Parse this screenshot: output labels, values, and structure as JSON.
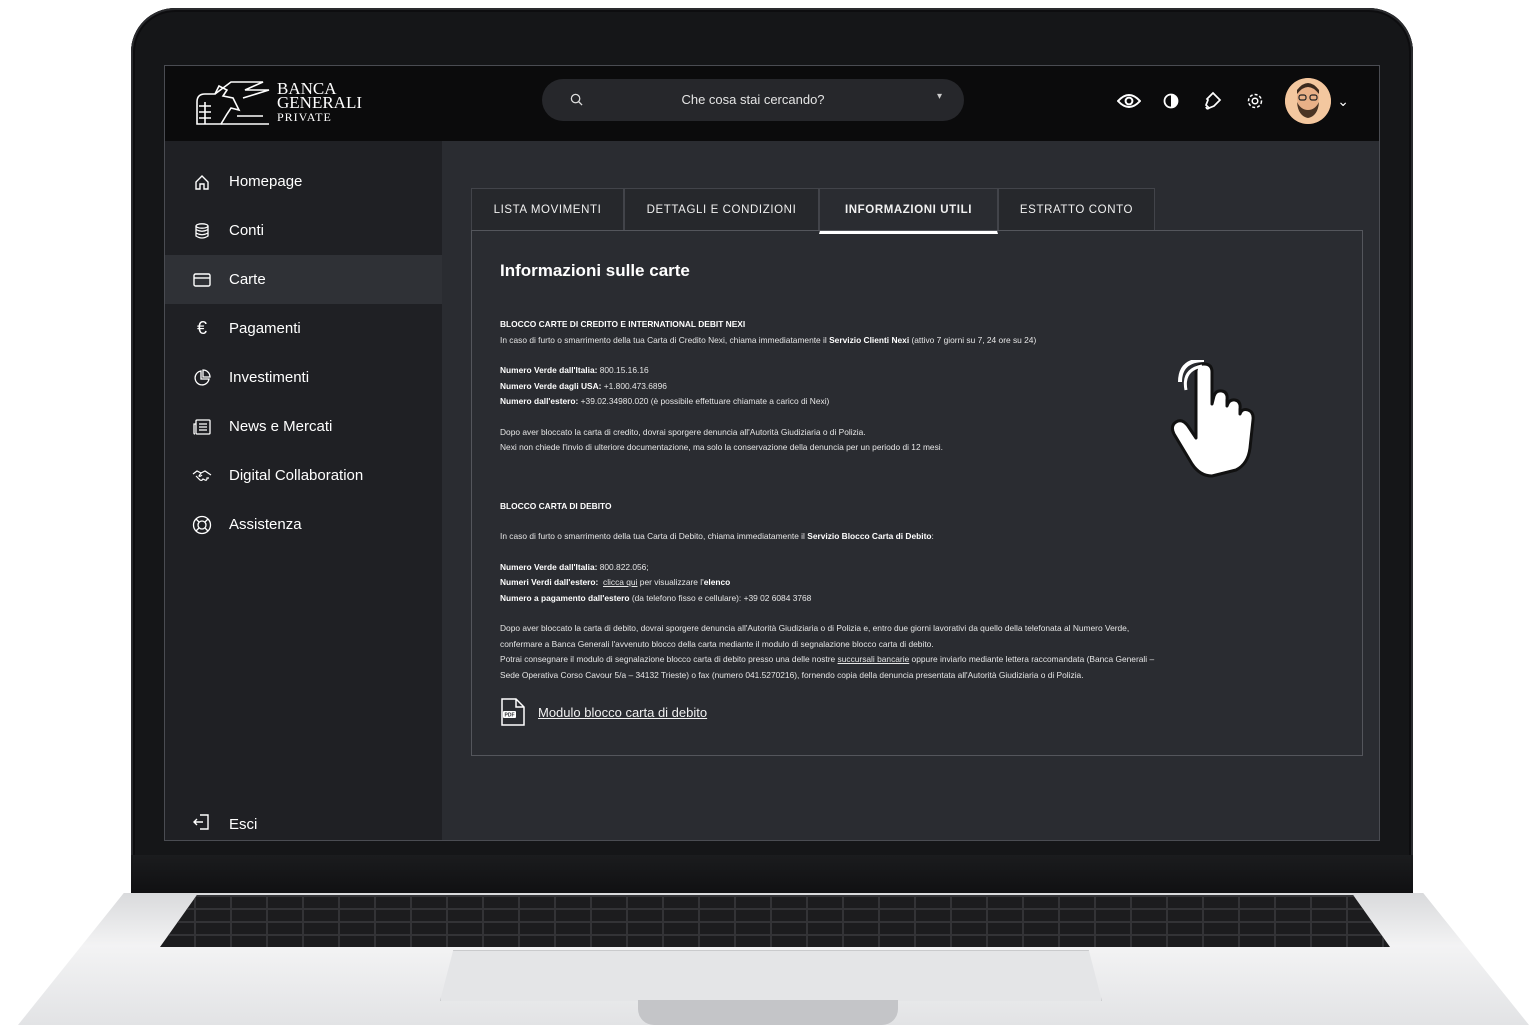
{
  "brand": {
    "line1": "BANCA",
    "line2": "GENERALI",
    "line3": "PRIVATE"
  },
  "search": {
    "placeholder": "Che cosa stai cercando?"
  },
  "sidebar": {
    "items": [
      {
        "label": "Homepage",
        "icon": "home-icon"
      },
      {
        "label": "Conti",
        "icon": "database-icon"
      },
      {
        "label": "Carte",
        "icon": "card-icon",
        "active": true
      },
      {
        "label": "Pagamenti",
        "icon": "euro-icon"
      },
      {
        "label": "Investimenti",
        "icon": "pie-chart-icon"
      },
      {
        "label": "News e Mercati",
        "icon": "news-icon"
      },
      {
        "label": "Digital Collaboration",
        "icon": "handshake-icon"
      },
      {
        "label": "Assistenza",
        "icon": "lifebuoy-icon"
      }
    ],
    "logout": "Esci"
  },
  "tabs": [
    {
      "label": "LISTA MOVIMENTI"
    },
    {
      "label": "DETTAGLI E CONDIZIONI"
    },
    {
      "label": "INFORMAZIONI UTILI",
      "active": true
    },
    {
      "label": "ESTRATTO CONTO"
    }
  ],
  "panel": {
    "title": "Informazioni sulle carte",
    "credit": {
      "heading": "BLOCCO CARTE DI CREDITO E INTERNATIONAL DEBIT NEXI",
      "intro_pre": "In caso di furto o smarrimento della tua Carta di Credito Nexi, chiama immediatamente il ",
      "intro_bold": "Servizio Clienti Nexi",
      "intro_post": " (attivo 7 giorni su 7, 24 ore su 24)",
      "n1_label": "Numero Verde dall'Italia:",
      "n1_value": " 800.15.16.16",
      "n2_label": "Numero Verde dagli USA:",
      "n2_value": " +1.800.473.6896",
      "n3_label": "Numero dall'estero:",
      "n3_value": "  +39.02.34980.020 (è possibile effettuare chiamate a carico di Nexi)",
      "note1": "Dopo aver bloccato la carta di credito, dovrai sporgere denuncia all'Autorità Giudiziaria o di Polizia.",
      "note2": "Nexi non chiede l'invio di ulteriore documentazione, ma solo la conservazione della denuncia per un periodo di 12 mesi."
    },
    "debit": {
      "heading": "BLOCCO CARTA DI DEBITO",
      "intro_pre": "In caso di furto o smarrimento della tua Carta di Debito, chiama immediatamente il ",
      "intro_bold": "Servizio Blocco Carta di Debito",
      "intro_post": ":",
      "n1_label": "Numero Verde dall'Italia:",
      "n1_value": " 800.822.056;",
      "n2_label": "Numeri Verdi dall'estero:",
      "n2_link": "clicca qui",
      "n2_mid": " per visualizzare l'",
      "n2_bold": "elenco",
      "n3_label": "Numero a pagamento dall'estero",
      "n3_value": " (da telefono fisso e cellulare): +39 02 6084 3768",
      "p1": "Dopo aver bloccato la carta di debito, dovrai sporgere denuncia all'Autorità Giudiziaria o di Polizia e, entro due giorni lavorativi da quello della telefonata al Numero Verde,",
      "p2": "confermare a Banca Generali l'avvenuto blocco della carta mediante il modulo di segnalazione blocco carta di debito.",
      "p3_pre": "Potrai consegnare il modulo di segnalazione blocco carta di debito presso una delle nostre ",
      "p3_link": "succursali bancarie",
      "p3_post": " oppure inviarlo mediante lettera raccomandata (Banca Generali –",
      "p4": "Sede Operativa Corso Cavour 5/a – 34132 Trieste) o fax (numero 041.5270216), fornendo copia della denuncia presentata all'Autorità Giudiziaria o di Polizia."
    },
    "pdf": {
      "label": "Modulo blocco carta di debito",
      "icon_text": "PDF"
    }
  }
}
